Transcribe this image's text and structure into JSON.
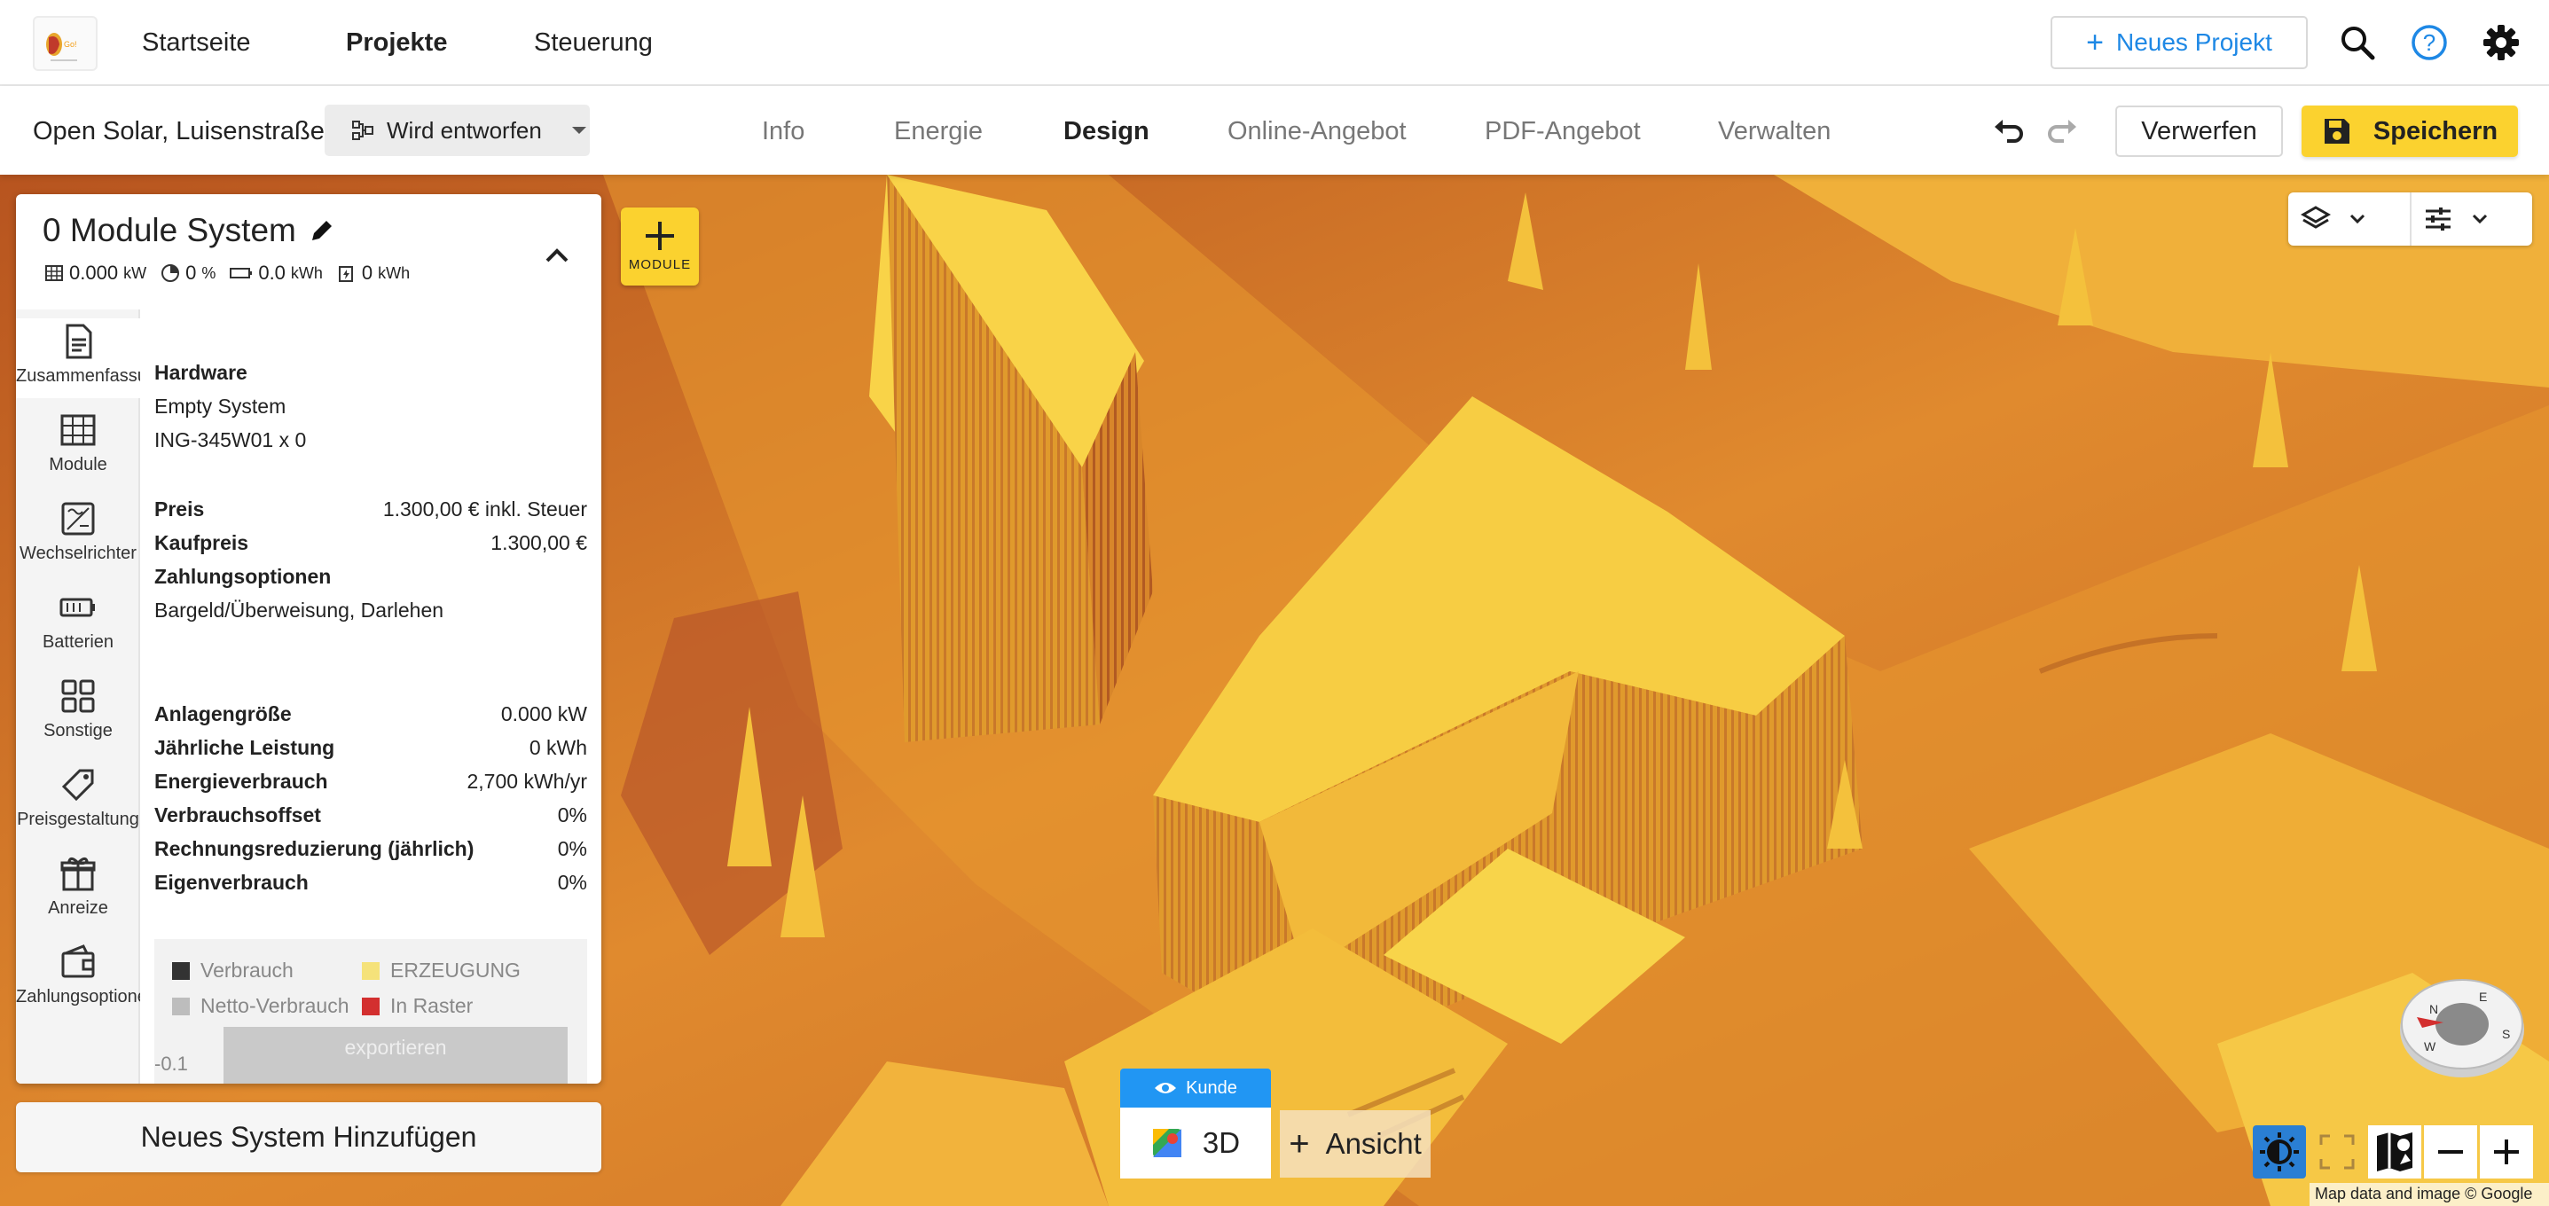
{
  "topnav": {
    "items": [
      "Startseite",
      "Projekte",
      "Steuerung"
    ],
    "new_project_label": "Neues Projekt",
    "accent_color": "#1e88e5"
  },
  "subbar": {
    "project_name": "Open Solar, Luisenstraße",
    "status_label": "Wird entworfen",
    "tabs": [
      "Info",
      "Energie",
      "Design",
      "Online-Angebot",
      "PDF-Angebot",
      "Verwalten"
    ],
    "active_tab": "Design",
    "discard_label": "Verwerfen",
    "save_label": "Speichern",
    "save_color": "#fbd22f"
  },
  "panel": {
    "title": "0 Module System",
    "stats": {
      "kw": "0.000",
      "kw_unit": "kW",
      "percent": "0",
      "percent_unit": "%",
      "battery": "0.0",
      "battery_unit": "kWh",
      "energy": "0",
      "energy_unit": "kWh"
    },
    "sidenav": [
      "Zusammenfassung",
      "Module",
      "Wechselrichter",
      "Batterien",
      "Sonstige",
      "Preisgestaltung",
      "Anreize",
      "Zahlungsoptionen"
    ],
    "hardware_heading": "Hardware",
    "hardware_lines": [
      "Empty System",
      "ING-345W01 x 0"
    ],
    "price_label": "Preis",
    "price_value": "1.300,00 € inkl. Steuer",
    "purchase_label": "Kaufpreis",
    "purchase_value": "1.300,00 €",
    "payment_heading": "Zahlungsoptionen",
    "payment_value": "Bargeld/Überweisung, Darlehen",
    "metrics": [
      {
        "label": "Anlagengröße",
        "value": "0.000 kW"
      },
      {
        "label": "Jährliche Leistung",
        "value": "0 kWh"
      },
      {
        "label": "Energieverbrauch",
        "value": "2,700 kWh/yr"
      },
      {
        "label": "Verbrauchsoffset",
        "value": "0%"
      },
      {
        "label": "Rechnungsreduzierung (jährlich)",
        "value": "0%"
      },
      {
        "label": "Eigenverbrauch",
        "value": "0%"
      }
    ],
    "legend": [
      {
        "label": "Verbrauch",
        "color": "#333333"
      },
      {
        "label": "ERZEUGUNG",
        "color": "#f5e27a"
      },
      {
        "label": "Netto-Verbrauch",
        "color": "#bdbdbd"
      },
      {
        "label": "In Raster",
        "color": "#d32f2f"
      }
    ],
    "export_label": "exportieren",
    "axis_value": "-0.1"
  },
  "add_system_label": "Neues System Hinzufügen",
  "add_module_label": "MODULE",
  "view": {
    "kunde_label": "Kunde",
    "threed_label": "3D",
    "ansicht_label": "Ansicht"
  },
  "map_credits": "Map data and image © Google"
}
